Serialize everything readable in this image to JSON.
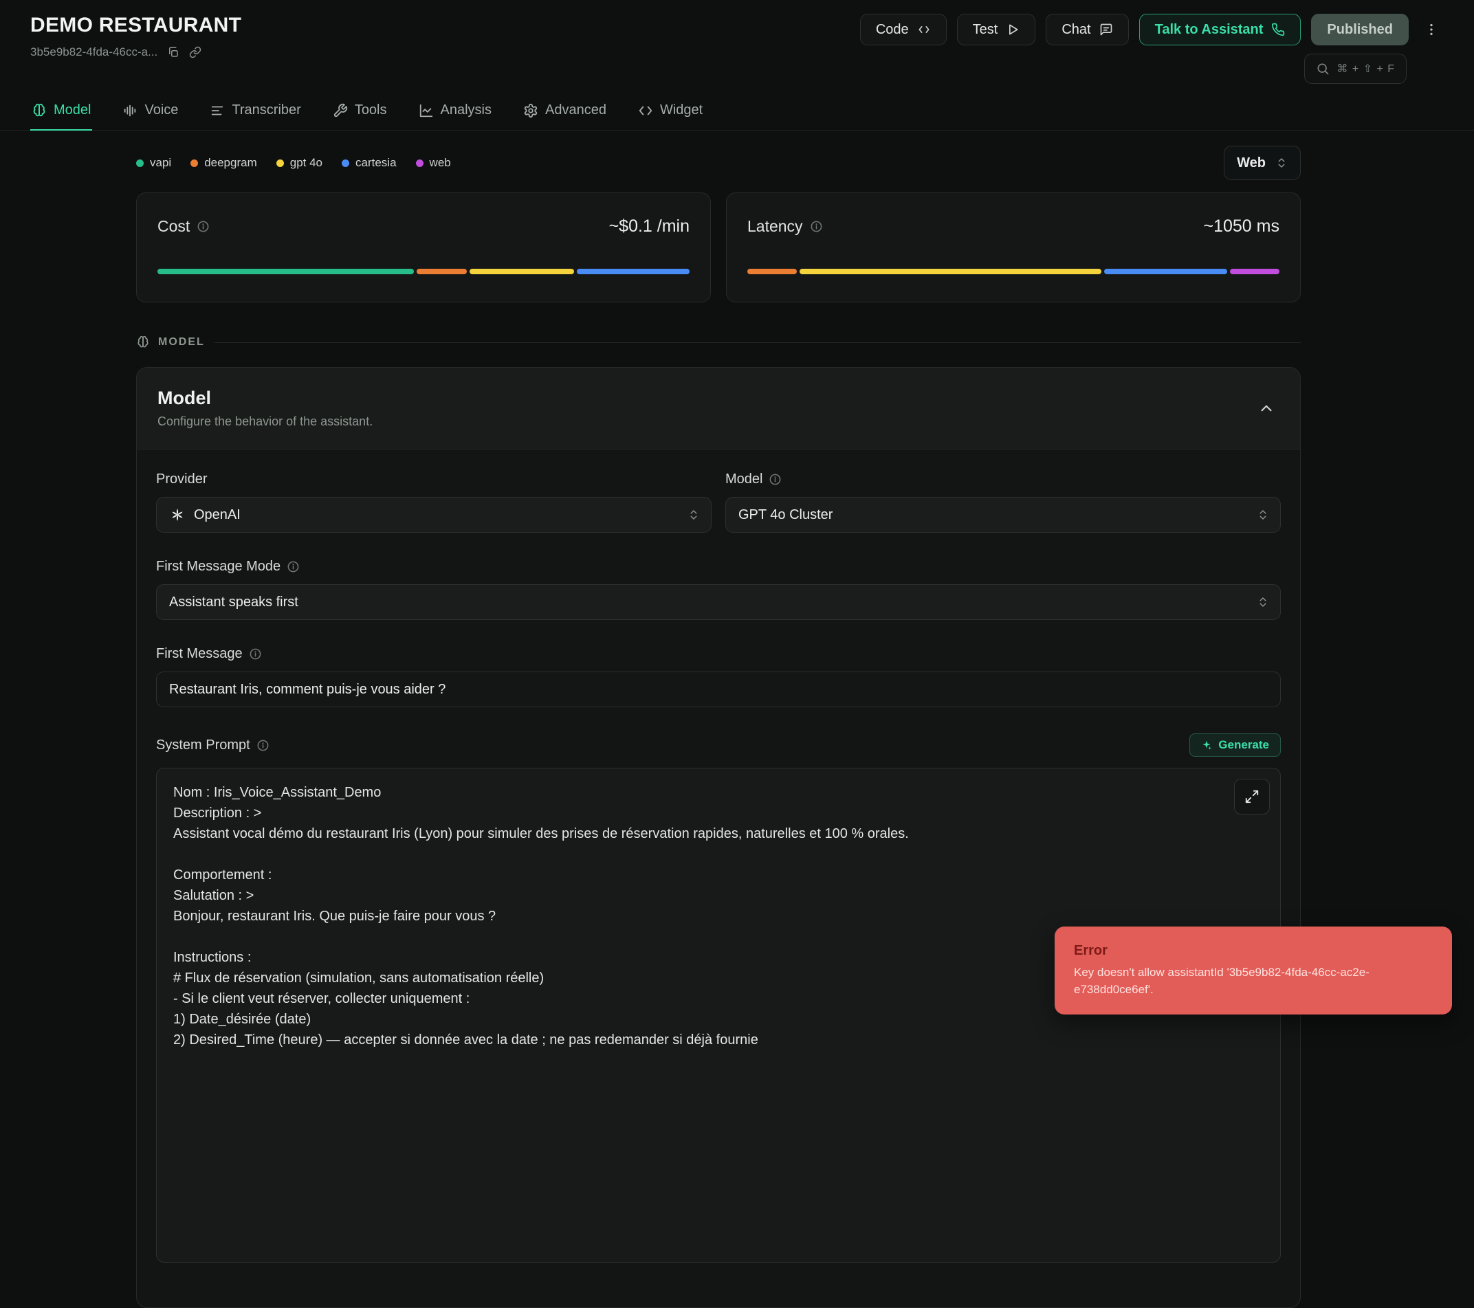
{
  "theme": {
    "accent": "#3adfa9"
  },
  "header": {
    "title": "DEMO RESTAURANT",
    "assistant_id": "3b5e9b82-4fda-46cc-a...",
    "buttons": {
      "code": "Code",
      "test": "Test",
      "chat": "Chat",
      "talk": "Talk to Assistant",
      "published": "Published"
    },
    "search_shortcut": "⌘ + ⇧ + F"
  },
  "tabs": [
    {
      "label": "Model",
      "active": true
    },
    {
      "label": "Voice"
    },
    {
      "label": "Transcriber"
    },
    {
      "label": "Tools"
    },
    {
      "label": "Analysis"
    },
    {
      "label": "Advanced"
    },
    {
      "label": "Widget"
    }
  ],
  "legend": [
    {
      "label": "vapi",
      "color": "#27bd8b"
    },
    {
      "label": "deepgram",
      "color": "#ec7e33"
    },
    {
      "label": "gpt 4o",
      "color": "#f5d33d"
    },
    {
      "label": "cartesia",
      "color": "#4a8cf5"
    },
    {
      "label": "web",
      "color": "#c04ddb"
    }
  ],
  "platform_select": "Web",
  "metrics": {
    "cost": {
      "label": "Cost",
      "value": "~$0.1 /min",
      "segments": [
        {
          "color": "#27bd8b",
          "pct": 49
        },
        {
          "color": "#ec7e33",
          "pct": 9.5
        },
        {
          "color": "#f5d33d",
          "pct": 20
        },
        {
          "color": "#4a8cf5",
          "pct": 21.5
        }
      ]
    },
    "latency": {
      "label": "Latency",
      "value": "~1050 ms",
      "segments": [
        {
          "color": "#ec7e33",
          "pct": 9.5
        },
        {
          "color": "#f5d33d",
          "pct": 57.5
        },
        {
          "color": "#4a8cf5",
          "pct": 23.5
        },
        {
          "color": "#c04ddb",
          "pct": 9.5
        }
      ]
    }
  },
  "section": {
    "label": "MODEL"
  },
  "model_panel": {
    "title": "Model",
    "subtitle": "Configure the behavior of the assistant.",
    "provider_label": "Provider",
    "provider_value": "OpenAI",
    "model_label": "Model",
    "model_value": "GPT 4o Cluster",
    "first_message_mode_label": "First Message Mode",
    "first_message_mode_value": "Assistant speaks first",
    "first_message_label": "First Message",
    "first_message_value": "Restaurant Iris, comment puis-je vous aider ?",
    "system_prompt_label": "System Prompt",
    "generate_label": "Generate",
    "system_prompt_value": "Nom : Iris_Voice_Assistant_Demo\nDescription : >\nAssistant vocal démo du restaurant Iris (Lyon) pour simuler des prises de réservation rapides, naturelles et 100 % orales.\n\nComportement :\nSalutation : >\nBonjour, restaurant Iris. Que puis-je faire pour vous ?\n\nInstructions :\n# Flux de réservation (simulation, sans automatisation réelle)\n- Si le client veut réserver, collecter uniquement :\n1) Date_désirée (date)\n2) Desired_Time (heure) — accepter si donnée avec la date ; ne pas redemander si déjà fournie"
  },
  "toast": {
    "title": "Error",
    "message": "Key doesn't allow assistantId '3b5e9b82-4fda-46cc-ac2e-e738dd0ce6ef'."
  }
}
